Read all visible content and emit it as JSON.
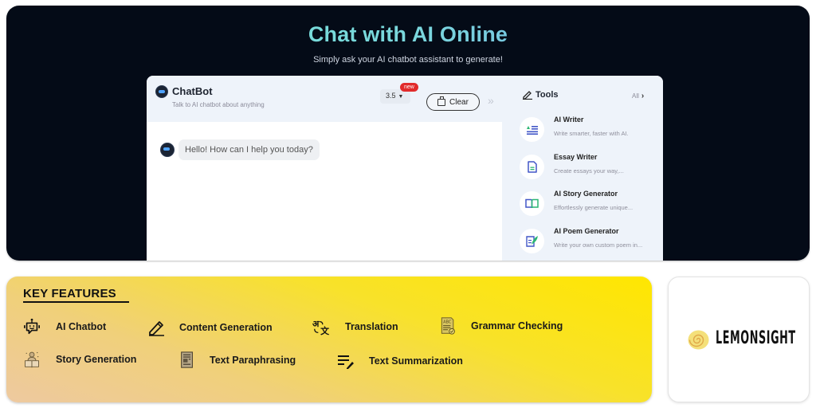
{
  "hero": {
    "title": "Chat with AI Online",
    "subtitle": "Simply ask your AI chatbot assistant to generate!",
    "background_color": "#040b17"
  },
  "chatbot": {
    "title": "ChatBot",
    "subtitle": "Talk to AI chatbot about anything",
    "model_value": "3.5",
    "new_badge": "new",
    "clear_label": "Clear",
    "collapse_glyph": "»",
    "messages": [
      {
        "sender": "bot",
        "text": "Hello! How can I help you today?"
      }
    ]
  },
  "tools": {
    "title": "Tools",
    "all_label": "All",
    "items": [
      {
        "name": "AI Writer",
        "desc": "Write smarter, faster with AI.",
        "icon": "text-lines-icon"
      },
      {
        "name": "Essay Writer",
        "desc": "Create essays your way,...",
        "icon": "document-icon"
      },
      {
        "name": "AI Story Generator",
        "desc": "Effortlessly generate unique...",
        "icon": "book-icon"
      },
      {
        "name": "AI Poem Generator",
        "desc": "Write your own custom poem in...",
        "icon": "quill-icon"
      }
    ]
  },
  "features": {
    "heading": "KEY FEATURES",
    "items": [
      {
        "label": "AI Chatbot",
        "icon": "robot-icon"
      },
      {
        "label": "Content Generation",
        "icon": "pencil-icon"
      },
      {
        "label": "Translation",
        "icon": "translate-icon"
      },
      {
        "label": "Grammar Checking",
        "icon": "grammar-check-icon"
      },
      {
        "label": "Story Generation",
        "icon": "storybook-icon"
      },
      {
        "label": "Text Paraphrasing",
        "icon": "paraphrase-document-icon"
      },
      {
        "label": "Text Summarization",
        "icon": "summarize-icon"
      }
    ]
  },
  "brand": {
    "name": "LEMONSIGHT",
    "accent_color": "#f0d060"
  }
}
